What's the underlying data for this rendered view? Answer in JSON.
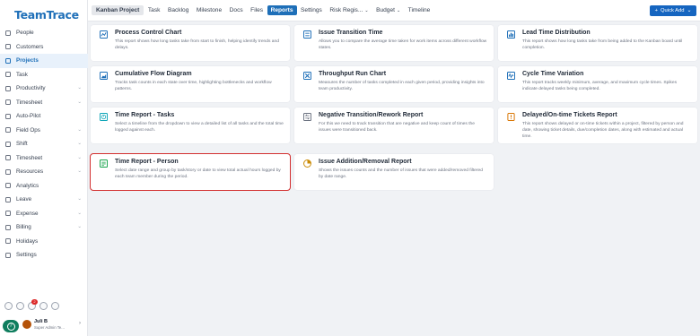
{
  "app": {
    "logo": "TeamTrace"
  },
  "sidebar": {
    "items": [
      {
        "label": "People",
        "chevron": ""
      },
      {
        "label": "Customers",
        "chevron": ""
      },
      {
        "label": "Projects",
        "chevron": "",
        "active": true
      },
      {
        "label": "Task",
        "chevron": ""
      },
      {
        "label": "Productivity",
        "chevron": "⌄"
      },
      {
        "label": "Timesheet",
        "chevron": "⌄"
      },
      {
        "label": "Auto-Pilot",
        "chevron": ""
      },
      {
        "label": "Field Ops",
        "chevron": "⌄"
      },
      {
        "label": "Shift",
        "chevron": "⌄"
      },
      {
        "label": "Timesheet",
        "chevron": "⌄"
      },
      {
        "label": "Resources",
        "chevron": "⌄"
      },
      {
        "label": "Analytics",
        "chevron": ""
      },
      {
        "label": "Leave",
        "chevron": "⌄"
      },
      {
        "label": "Expense",
        "chevron": "⌄"
      },
      {
        "label": "Billing",
        "chevron": "⌄"
      },
      {
        "label": "Holidays",
        "chevron": ""
      },
      {
        "label": "Settings",
        "chevron": ""
      }
    ],
    "notification_count": "2",
    "user": {
      "name": "Juli B",
      "role": "Super Admin Te..."
    }
  },
  "topbar": {
    "tabs": [
      "Kanban Project",
      "Task",
      "Backlog",
      "Milestone",
      "Docs",
      "Files",
      "Reports",
      "Settings",
      "Risk Regis...",
      "Budget",
      "Timeline"
    ],
    "tab_carets": {
      "8": "⌄",
      "9": "⌄"
    },
    "active_tab": "Reports",
    "quick_add": "Quick Add",
    "quick_add_caret": "⌄"
  },
  "reports": [
    {
      "title": "Process Control Chart",
      "desc": "This report shows how long tasks take from start to finish, helping identify trends and delays.",
      "icon": "process-control-icon",
      "color": "#1e6fb8"
    },
    {
      "title": "Issue Transition Time",
      "desc": "Allows you to compare the average time taken for work items across different workflow states.",
      "icon": "transition-time-icon",
      "color": "#1e6fb8"
    },
    {
      "title": "Lead Time Distribution",
      "desc": "This report shows how long tasks take from being added to the Kanban board until completion.",
      "icon": "lead-time-icon",
      "color": "#1e6fb8"
    },
    {
      "title": "Cumulative Flow Diagram",
      "desc": "Tracks task counts in each state over time, highlighting bottlenecks and workflow patterns.",
      "icon": "cumulative-flow-icon",
      "color": "#1e6fb8"
    },
    {
      "title": "Throughput Run Chart",
      "desc": "Measures the number of tasks completed in each given period, providing insights into team productivity.",
      "icon": "throughput-icon",
      "color": "#1e6fb8"
    },
    {
      "title": "Cycle Time Variation",
      "desc": "This report tracks weekly minimum, average, and maximum cycle times. Spikes indicate delayed tasks being completed.",
      "icon": "cycle-time-icon",
      "color": "#1e6fb8"
    },
    {
      "title": "Time Report - Tasks",
      "desc": "Select a timeline from the dropdown to view a detailed list of all tasks and the total time logged against each.",
      "icon": "time-report-tasks-icon",
      "color": "#0ea5b7"
    },
    {
      "title": "Negative Transition/Rework Report",
      "desc": "For this we need to track transition that are negative and keep count of times the issues were transitioned back.",
      "icon": "negative-transition-icon",
      "color": "#6b7280"
    },
    {
      "title": "Delayed/On-time Tickets Report",
      "desc": "This report shows delayed or on-time tickets within a project, filtered by person and date, showing ticket details, due/completion dates, along with estimated and actual time.",
      "icon": "delayed-tickets-icon",
      "color": "#d97706"
    },
    {
      "title": "Time Report - Person",
      "desc": "Select date range and group by task/story or date to view total actual hours logged by each team member during the period.",
      "icon": "time-report-person-icon",
      "color": "#16a34a"
    },
    {
      "title": "Issue Addition/Removal Report",
      "desc": "Shows the issues counts and the number of issues that were added/removed filtered by date range.",
      "icon": "issue-addition-icon",
      "color": "#ca8a04"
    }
  ]
}
